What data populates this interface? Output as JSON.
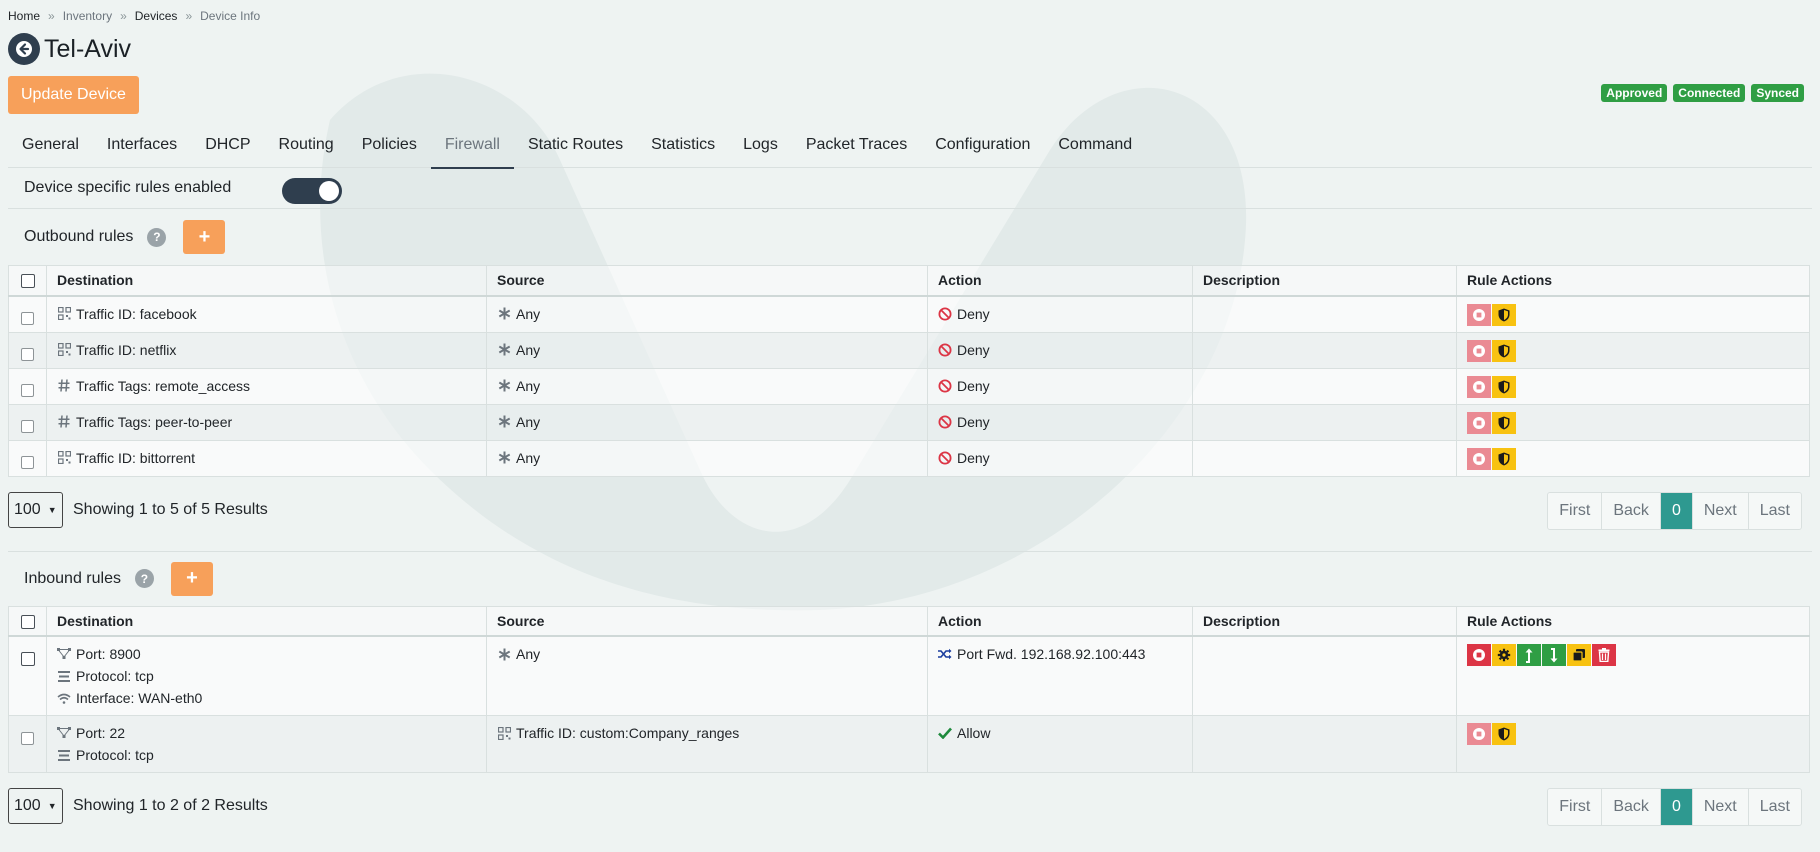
{
  "breadcrumb": {
    "home": "Home",
    "inventory": "Inventory",
    "devices": "Devices",
    "current": "Device Info",
    "separator": "»"
  },
  "header": {
    "title": "Tel-Aviv",
    "update_label": "Update Device",
    "badges": [
      "Approved",
      "Connected",
      "Synced"
    ]
  },
  "tabs": [
    "General",
    "Interfaces",
    "DHCP",
    "Routing",
    "Policies",
    "Firewall",
    "Static Routes",
    "Statistics",
    "Logs",
    "Packet Traces",
    "Configuration",
    "Command"
  ],
  "active_tab": "Firewall",
  "toggle": {
    "label": "Device specific rules enabled",
    "enabled": true
  },
  "columns": {
    "destination": "Destination",
    "source": "Source",
    "action": "Action",
    "description": "Description",
    "rule_actions": "Rule Actions"
  },
  "outbound": {
    "title": "Outbound rules",
    "help": "?",
    "add": "+",
    "rows": [
      {
        "dest_icon": "traffic-id-icon",
        "dest": "Traffic ID: facebook",
        "src_icon": "asterisk-icon",
        "src": "Any",
        "action_icon": "deny-icon",
        "action": "Deny"
      },
      {
        "dest_icon": "traffic-id-icon",
        "dest": "Traffic ID: netflix",
        "src_icon": "asterisk-icon",
        "src": "Any",
        "action_icon": "deny-icon",
        "action": "Deny"
      },
      {
        "dest_icon": "hash-icon",
        "dest": "Traffic Tags: remote_access",
        "src_icon": "asterisk-icon",
        "src": "Any",
        "action_icon": "deny-icon",
        "action": "Deny"
      },
      {
        "dest_icon": "hash-icon",
        "dest": "Traffic Tags: peer-to-peer",
        "src_icon": "asterisk-icon",
        "src": "Any",
        "action_icon": "deny-icon",
        "action": "Deny"
      },
      {
        "dest_icon": "traffic-id-icon",
        "dest": "Traffic ID: bittorrent",
        "src_icon": "asterisk-icon",
        "src": "Any",
        "action_icon": "deny-icon",
        "action": "Deny"
      }
    ],
    "page_size": "100",
    "showing": "Showing 1 to 5 of 5 Results"
  },
  "inbound": {
    "title": "Inbound rules",
    "help": "?",
    "add": "+",
    "rows": [
      {
        "port": "Port: 8900",
        "protocol": "Protocol: tcp",
        "interface": "Interface: WAN-eth0",
        "src": "Any",
        "action": "Port Fwd. 192.168.92.100:443"
      },
      {
        "port": "Port: 22",
        "protocol": "Protocol: tcp",
        "src": "Traffic ID: custom:Company_ranges",
        "action": "Allow"
      }
    ],
    "page_size": "100",
    "showing": "Showing 1 to 2 of 2 Results"
  },
  "pager": {
    "first": "First",
    "back": "Back",
    "current": "0",
    "next": "Next",
    "last": "Last"
  },
  "colors": {
    "accent_orange": "#f7a05a",
    "badge_green": "#2f9e44",
    "pager_active": "#2e9990",
    "deny_red": "#dc3545",
    "warn_yellow": "#f8c211"
  }
}
